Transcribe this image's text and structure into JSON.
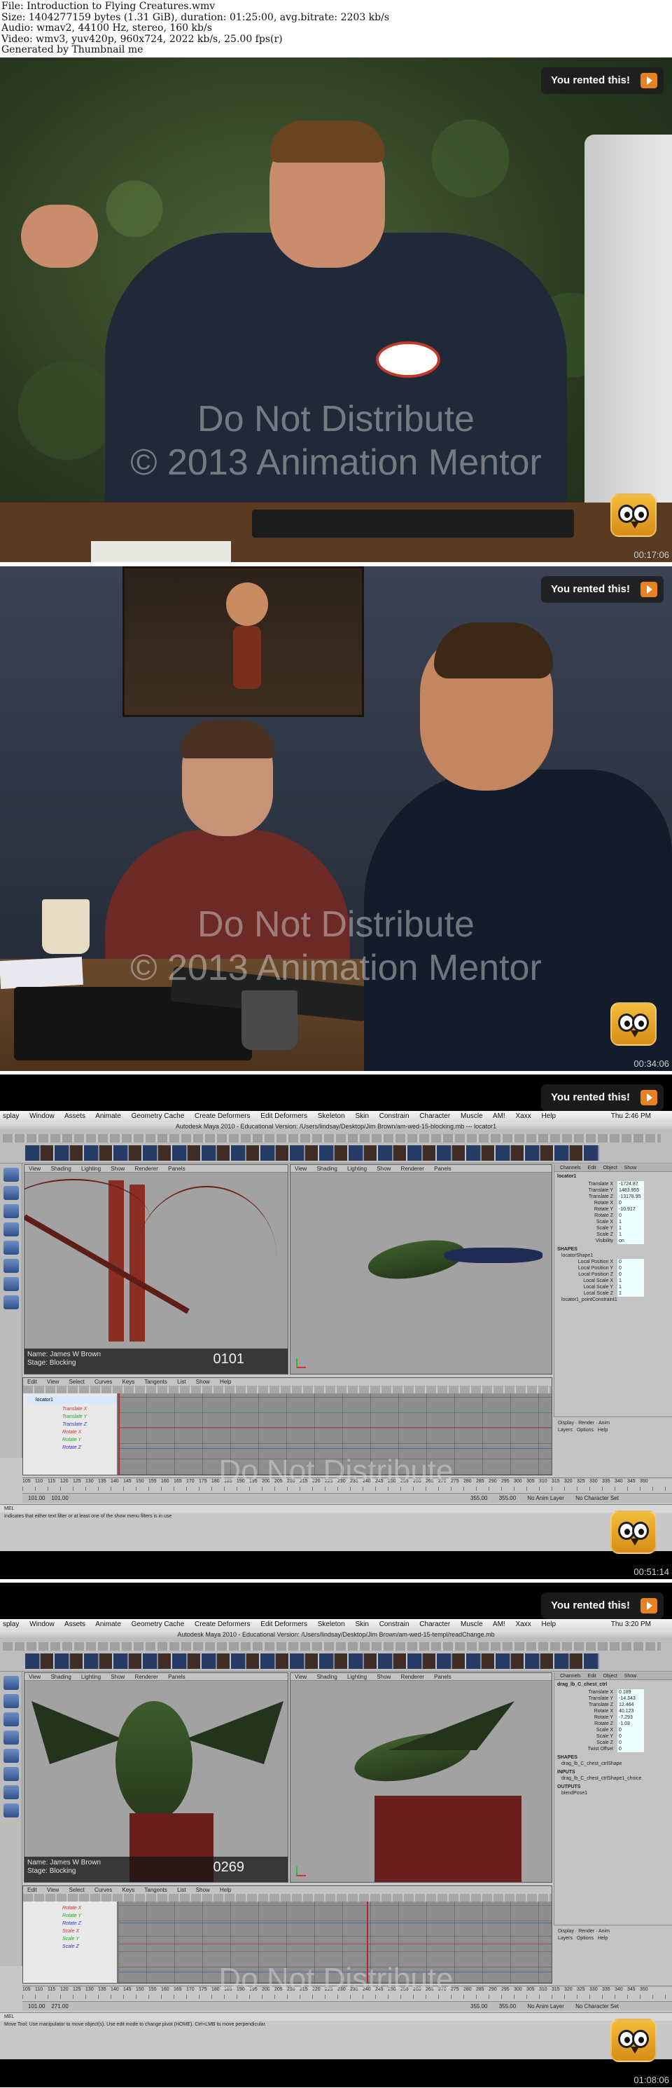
{
  "info": {
    "line1": "File: Introduction to Flying Creatures.wmv",
    "line2": "Size: 1404277159 bytes (1.31 GiB), duration: 01:25:00, avg.bitrate: 2203 kb/s",
    "line3": "Audio: wmav2, 44100 Hz, stereo, 160 kb/s",
    "line4": "Video: wmv3, yuv420p, 960x724, 2022 kb/s, 25.00 fps(r)",
    "line5": "Generated by Thumbnail me"
  },
  "overlay": {
    "rented": "You rented this!",
    "icon": "play-arrow-icon",
    "logo": "animation-mentor-owl-logo",
    "accent": "#e8811f"
  },
  "watermark": {
    "line1": "Do Not Distribute",
    "line2": "© 2013 Animation Mentor"
  },
  "thumbnails": [
    {
      "timestamp": "00:17:06"
    },
    {
      "timestamp": "00:34:06"
    },
    {
      "timestamp": "00:51:14"
    },
    {
      "timestamp": "01:08:06"
    }
  ],
  "maya": {
    "menu": [
      "splay",
      "Window",
      "Assets",
      "Animate",
      "Geometry Cache",
      "Create Deformers",
      "Edit Deformers",
      "Skeleton",
      "Skin",
      "Constrain",
      "Character",
      "Muscle",
      "AM!",
      "Xaxx",
      "Help"
    ],
    "clock3": "Thu 2:46 PM",
    "clock4": "Thu 3:20 PM",
    "title3": "Autodesk Maya 2010 - Educational Version: /Users/lindsay/Desktop/Jim Brown/am-wed-15-blocking.mb --- locator1",
    "title4": "Autodesk Maya 2010 - Educational Version: /Users/lindsay/Desktop/Jim Brown/am-wed-15-templ/readChange.mb",
    "viewport_menu": [
      "View",
      "Shading",
      "Lighting",
      "Show",
      "Renderer",
      "Panels"
    ],
    "graph_menu": [
      "Edit",
      "View",
      "Select",
      "Curves",
      "Keys",
      "Tangents",
      "List",
      "Show",
      "Help"
    ],
    "hud_name": "Name: James W Brown",
    "hud_stage": "Stage: Blocking",
    "frame3": "0101",
    "frame4": "0269",
    "channel_tabs": [
      "Channels",
      "Edit",
      "Object",
      "Show"
    ],
    "chan3": {
      "object": "locator1",
      "rows": [
        {
          "k": "Translate X",
          "v": "-1724.87"
        },
        {
          "k": "Translate Y",
          "v": "1483.955"
        },
        {
          "k": "Translate Z",
          "v": "-13178.95"
        },
        {
          "k": "Rotate X",
          "v": "0"
        },
        {
          "k": "Rotate Y",
          "v": "-10.917"
        },
        {
          "k": "Rotate Z",
          "v": "0"
        },
        {
          "k": "Scale X",
          "v": "1"
        },
        {
          "k": "Scale Y",
          "v": "1"
        },
        {
          "k": "Scale Z",
          "v": "1"
        },
        {
          "k": "Visibility",
          "v": "on"
        }
      ],
      "shapes_label": "SHAPES",
      "shape_name": "locatorShape1",
      "shape_rows": [
        {
          "k": "Local Position X",
          "v": "0"
        },
        {
          "k": "Local Position Y",
          "v": "0"
        },
        {
          "k": "Local Position Z",
          "v": "0"
        },
        {
          "k": "Local Scale X",
          "v": "1"
        },
        {
          "k": "Local Scale Y",
          "v": "1"
        },
        {
          "k": "Local Scale Z",
          "v": "1"
        }
      ],
      "constraint": "locator1_pointConstraint1"
    },
    "chan4": {
      "object": "drag_lb_C_chest_ctrl",
      "rows": [
        {
          "k": "Translate X",
          "v": "0.189"
        },
        {
          "k": "Translate Y",
          "v": "-14.343"
        },
        {
          "k": "Translate Z",
          "v": "12.464"
        },
        {
          "k": "Rotate X",
          "v": "40.123"
        },
        {
          "k": "Rotate Y",
          "v": "-7.293"
        },
        {
          "k": "Rotate Z",
          "v": "-1.03"
        },
        {
          "k": "Scale X",
          "v": "0"
        },
        {
          "k": "Scale Y",
          "v": "0"
        },
        {
          "k": "Scale Z",
          "v": "0"
        },
        {
          "k": "Twist Offset",
          "v": "0"
        }
      ],
      "shapes_label": "SHAPES",
      "shape_name": "drag_lb_C_chest_ctrlShape",
      "inputs_label": "INPUTS",
      "input_name": "drag_lb_C_chest_ctrlShape1_choice",
      "outputs_label": "OUTPUTS",
      "output_name": "blendPose1"
    },
    "layer_tabs": [
      "Display",
      "Render",
      "Anim"
    ],
    "layer_menu": [
      "Layers",
      "Options",
      "Help"
    ],
    "outliner3": {
      "object": "locator1",
      "channels": [
        "Translate X",
        "Translate Y",
        "Translate Z",
        "Rotate X",
        "Rotate Y",
        "Rotate Z"
      ]
    },
    "outliner4": {
      "channels": [
        "Rotate X",
        "Rotate Y",
        "Rotate Z",
        "Scale X",
        "Scale Y",
        "Scale Z"
      ]
    },
    "timeline_ticks": [
      "105",
      "110",
      "115",
      "120",
      "125",
      "130",
      "135",
      "140",
      "145",
      "150",
      "155",
      "160",
      "165",
      "170",
      "175",
      "180",
      "185",
      "190",
      "195",
      "200",
      "205",
      "210",
      "215",
      "220",
      "225",
      "230",
      "235",
      "240",
      "245",
      "250",
      "255",
      "260",
      "265",
      "270",
      "275",
      "280",
      "285",
      "290",
      "295",
      "300",
      "305",
      "310",
      "315",
      "320",
      "325",
      "330",
      "335",
      "340",
      "345",
      "350"
    ],
    "current_frame3": "101.00",
    "current_frame4": "271.00",
    "range_start": "101.00",
    "range_end": "355.00",
    "range_end2": "355.00",
    "anim_layer": "No Anim Layer",
    "char_set": "No Character Set",
    "cmd_label": "MEL",
    "help3": "Indicates that either text filter or at least one of the show menu filters is in use",
    "help4": "Move Tool: Use manipulator to move object(s). Use edit mode to change pivot (HOME). Ctrl+LMB to move perpendicular."
  }
}
